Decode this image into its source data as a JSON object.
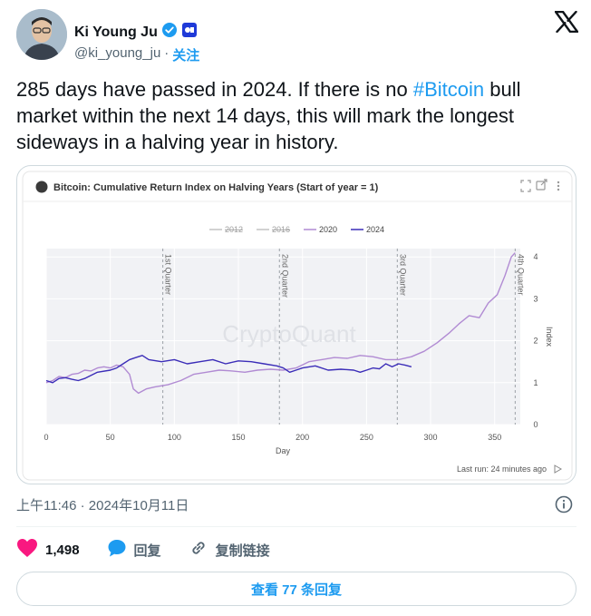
{
  "author": {
    "name": "Ki Young Ju",
    "handle": "@ki_young_ju",
    "separator": "·",
    "follow_label": "关注"
  },
  "tweet": {
    "text_before": "285 days have passed in 2024. If there is no ",
    "hashtag": "#Bitcoin",
    "text_after": " bull market within the next 14 days, this will mark the longest sideways in a halving year in history."
  },
  "chart_card": {
    "watermark": "CryptoQuant",
    "last_run": "Last run: 24 minutes ago"
  },
  "chart_data": {
    "type": "line",
    "title": "Bitcoin: Cumulative Return Index on Halving Years (Start of year = 1)",
    "xlabel": "Day",
    "ylabel": "Index",
    "xlim": [
      0,
      370
    ],
    "ylim": [
      0,
      4.2
    ],
    "x_ticks": [
      0,
      50,
      100,
      150,
      200,
      250,
      300,
      350
    ],
    "y_ticks": [
      0,
      1,
      2,
      3,
      4
    ],
    "grid": true,
    "legend_position": "top-center",
    "quarters": [
      {
        "label": "1st Quarter",
        "day": 91
      },
      {
        "label": "2nd Quarter",
        "day": 182
      },
      {
        "label": "3rd Quarter",
        "day": 274
      },
      {
        "label": "4th Quarter",
        "day": 366
      }
    ],
    "series": [
      {
        "name": "2012",
        "color": "#c4c4c4",
        "hidden": true,
        "points": []
      },
      {
        "name": "2016",
        "color": "#c4c4c4",
        "hidden": true,
        "points": []
      },
      {
        "name": "2020",
        "color": "#b18bd3",
        "points": [
          [
            0,
            1.0
          ],
          [
            5,
            1.05
          ],
          [
            10,
            1.15
          ],
          [
            15,
            1.12
          ],
          [
            20,
            1.2
          ],
          [
            25,
            1.22
          ],
          [
            30,
            1.3
          ],
          [
            35,
            1.28
          ],
          [
            40,
            1.35
          ],
          [
            45,
            1.38
          ],
          [
            50,
            1.35
          ],
          [
            55,
            1.42
          ],
          [
            60,
            1.38
          ],
          [
            65,
            1.2
          ],
          [
            68,
            0.85
          ],
          [
            72,
            0.75
          ],
          [
            78,
            0.85
          ],
          [
            85,
            0.9
          ],
          [
            95,
            0.95
          ],
          [
            105,
            1.05
          ],
          [
            115,
            1.2
          ],
          [
            125,
            1.25
          ],
          [
            135,
            1.3
          ],
          [
            145,
            1.28
          ],
          [
            155,
            1.25
          ],
          [
            165,
            1.3
          ],
          [
            175,
            1.32
          ],
          [
            185,
            1.3
          ],
          [
            195,
            1.35
          ],
          [
            205,
            1.5
          ],
          [
            215,
            1.55
          ],
          [
            225,
            1.6
          ],
          [
            235,
            1.58
          ],
          [
            245,
            1.65
          ],
          [
            255,
            1.62
          ],
          [
            265,
            1.55
          ],
          [
            275,
            1.55
          ],
          [
            285,
            1.62
          ],
          [
            295,
            1.75
          ],
          [
            305,
            1.95
          ],
          [
            315,
            2.2
          ],
          [
            322,
            2.4
          ],
          [
            330,
            2.6
          ],
          [
            338,
            2.55
          ],
          [
            345,
            2.9
          ],
          [
            352,
            3.1
          ],
          [
            358,
            3.55
          ],
          [
            363,
            4.0
          ],
          [
            366,
            4.1
          ]
        ]
      },
      {
        "name": "2024",
        "color": "#3b2db8",
        "points": [
          [
            0,
            1.05
          ],
          [
            5,
            1.0
          ],
          [
            10,
            1.1
          ],
          [
            15,
            1.12
          ],
          [
            20,
            1.08
          ],
          [
            25,
            1.05
          ],
          [
            30,
            1.1
          ],
          [
            40,
            1.25
          ],
          [
            50,
            1.3
          ],
          [
            55,
            1.35
          ],
          [
            60,
            1.45
          ],
          [
            65,
            1.55
          ],
          [
            70,
            1.6
          ],
          [
            75,
            1.65
          ],
          [
            80,
            1.55
          ],
          [
            90,
            1.5
          ],
          [
            100,
            1.55
          ],
          [
            110,
            1.45
          ],
          [
            120,
            1.5
          ],
          [
            130,
            1.55
          ],
          [
            140,
            1.45
          ],
          [
            150,
            1.52
          ],
          [
            160,
            1.5
          ],
          [
            170,
            1.45
          ],
          [
            180,
            1.4
          ],
          [
            185,
            1.35
          ],
          [
            190,
            1.25
          ],
          [
            195,
            1.3
          ],
          [
            200,
            1.35
          ],
          [
            210,
            1.4
          ],
          [
            220,
            1.3
          ],
          [
            230,
            1.32
          ],
          [
            240,
            1.3
          ],
          [
            245,
            1.25
          ],
          [
            250,
            1.3
          ],
          [
            255,
            1.35
          ],
          [
            260,
            1.33
          ],
          [
            265,
            1.45
          ],
          [
            270,
            1.38
          ],
          [
            275,
            1.45
          ],
          [
            280,
            1.42
          ],
          [
            285,
            1.38
          ]
        ]
      }
    ]
  },
  "meta": {
    "timestamp": "上午11:46 · 2024年10月11日"
  },
  "actions": {
    "likes": "1,498",
    "reply_label": "回复",
    "copy_link_label": "复制链接"
  },
  "replies_button": "查看 77 条回复"
}
